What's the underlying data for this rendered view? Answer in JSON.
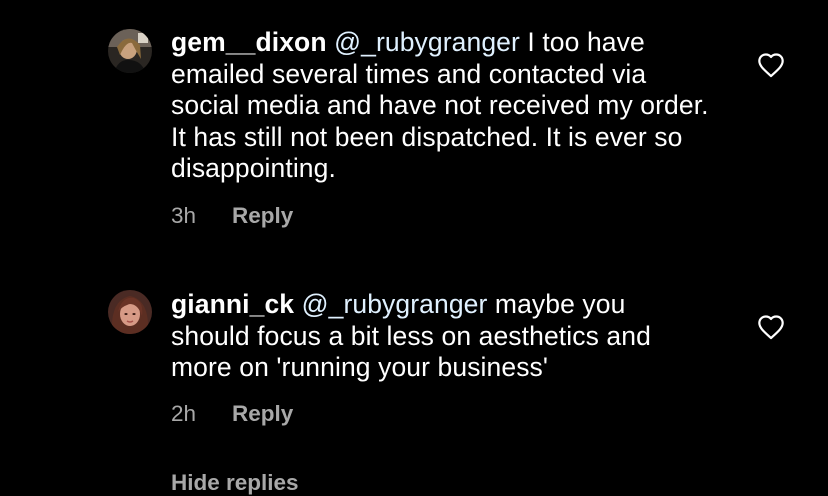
{
  "comments": [
    {
      "username": "gem__dixon",
      "mention": "@_rubygranger",
      "text": " I too have emailed several times and contacted via social media and have not received my order.  It has still not been dispatched. It is ever so disappointing.",
      "time": "3h",
      "reply_label": "Reply",
      "like_icon": "heart-outline-icon"
    },
    {
      "username": "gianni_ck",
      "mention": "@_rubygranger",
      "text": " maybe you should focus a bit less on aesthetics and more on 'running your business'",
      "time": "2h",
      "reply_label": "Reply",
      "like_icon": "heart-outline-icon"
    }
  ],
  "hide_replies_label": "Hide replies",
  "colors": {
    "background": "#000000",
    "text": "#ffffff",
    "mention": "#e0f1ff",
    "secondary": "#a8a8a8"
  }
}
